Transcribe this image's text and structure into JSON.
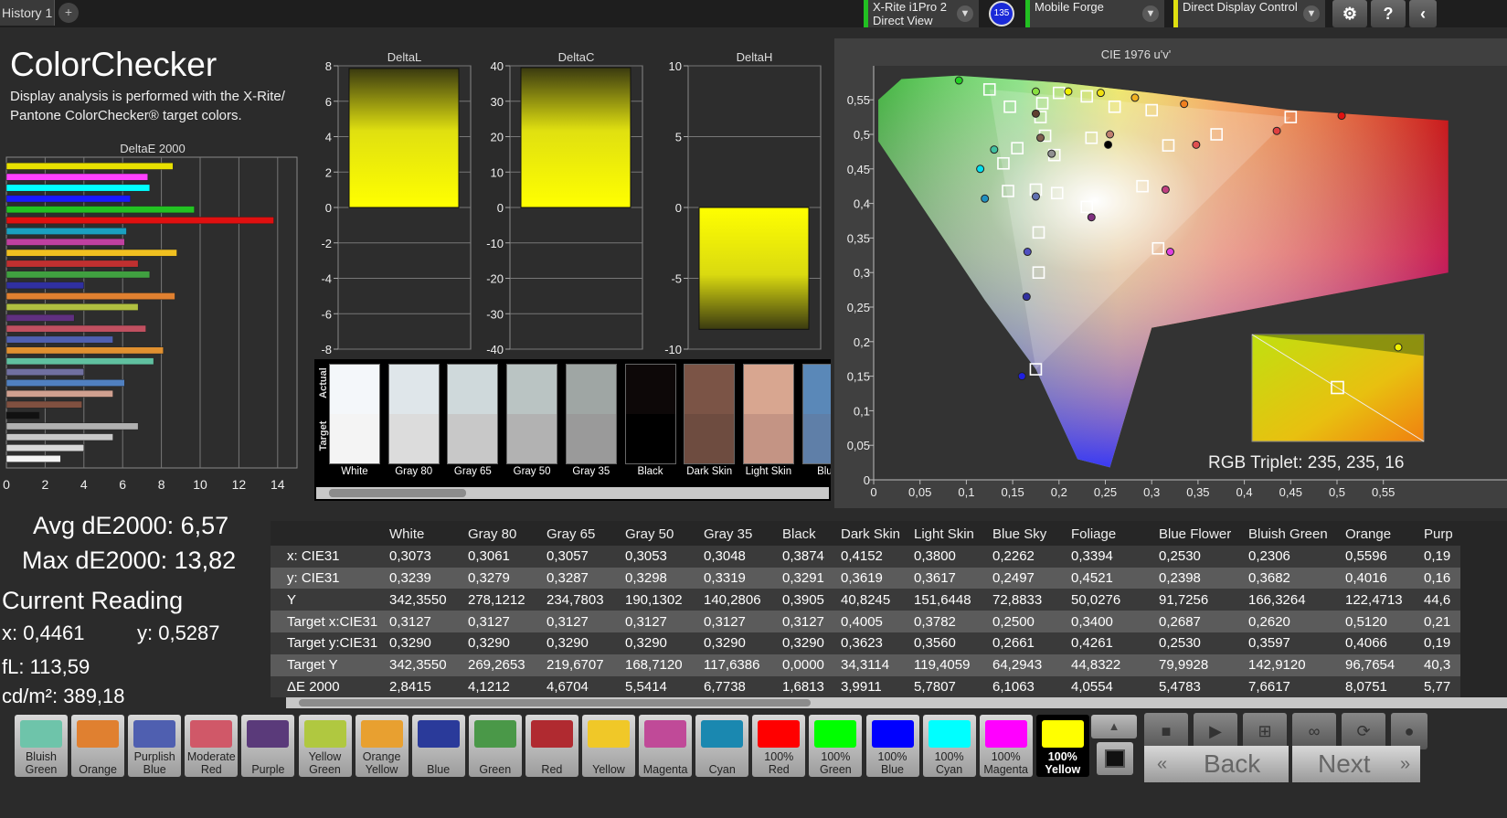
{
  "topbar": {
    "tab_label": "History 1",
    "add_tab": "+",
    "meter": {
      "line1": "X-Rite i1Pro 2",
      "line2": "Direct View"
    },
    "badge": "135",
    "profile": "Mobile Forge",
    "display_control": "Direct Display Control"
  },
  "header": {
    "title": "ColorChecker",
    "subtitle": "Display analysis is performed with the X-Rite/ Pantone ColorChecker® target colors."
  },
  "deltae_chart": {
    "title": "DeltaE 2000",
    "ticks": [
      "0",
      "2",
      "4",
      "6",
      "8",
      "10",
      "12",
      "14"
    ],
    "max": 15,
    "bars": [
      {
        "value": 8.6,
        "color": "#e8e000"
      },
      {
        "value": 7.3,
        "color": "#ff40ff"
      },
      {
        "value": 7.4,
        "color": "#00ffff"
      },
      {
        "value": 6.4,
        "color": "#1a1aff"
      },
      {
        "value": 9.7,
        "color": "#22c222"
      },
      {
        "value": 13.8,
        "color": "#e01010"
      },
      {
        "value": 6.2,
        "color": "#1aa0c0"
      },
      {
        "value": 6.1,
        "color": "#c040a0"
      },
      {
        "value": 8.8,
        "color": "#f0c020"
      },
      {
        "value": 6.8,
        "color": "#c03030"
      },
      {
        "value": 7.4,
        "color": "#40a040"
      },
      {
        "value": 4.0,
        "color": "#3030a0"
      },
      {
        "value": 8.7,
        "color": "#e08030"
      },
      {
        "value": 6.8,
        "color": "#b0c040"
      },
      {
        "value": 3.5,
        "color": "#603080"
      },
      {
        "value": 7.2,
        "color": "#c05060"
      },
      {
        "value": 5.5,
        "color": "#5060b0"
      },
      {
        "value": 8.1,
        "color": "#e09030"
      },
      {
        "value": 7.6,
        "color": "#60c0a0"
      },
      {
        "value": 4.0,
        "color": "#7070a0"
      },
      {
        "value": 6.1,
        "color": "#5080c0"
      },
      {
        "value": 5.5,
        "color": "#d0a090"
      },
      {
        "value": 3.9,
        "color": "#805040"
      },
      {
        "value": 1.7,
        "color": "#111111"
      },
      {
        "value": 6.8,
        "color": "#b0b0b0"
      },
      {
        "value": 5.5,
        "color": "#c8c8c8"
      },
      {
        "value": 4.0,
        "color": "#d8d8d8"
      },
      {
        "value": 2.8,
        "color": "#f4f4f4"
      }
    ]
  },
  "bar_charts": [
    {
      "title": "DeltaL",
      "ticks": [
        "8",
        "6",
        "4",
        "2",
        "0",
        "-2",
        "-4",
        "-6",
        "-8"
      ],
      "min": -8,
      "max": 8,
      "value": 7.85
    },
    {
      "title": "DeltaC",
      "ticks": [
        "40",
        "30",
        "20",
        "10",
        "0",
        "-10",
        "-20",
        "-30",
        "-40"
      ],
      "min": -40,
      "max": 40,
      "value": 39.5
    },
    {
      "title": "DeltaH",
      "ticks": [
        "10",
        "5",
        "0",
        "-5",
        "-10"
      ],
      "min": -10,
      "max": 10,
      "value": -8.6
    }
  ],
  "comparison": {
    "actual_label": "Actual",
    "target_label": "Target",
    "patches": [
      {
        "name": "White",
        "actual": "#f4f7fa",
        "target": "#f4f4f4"
      },
      {
        "name": "Gray 80",
        "actual": "#dfe6ea",
        "target": "#dcdcdc"
      },
      {
        "name": "Gray 65",
        "actual": "#cfd9db",
        "target": "#c8c8c8"
      },
      {
        "name": "Gray 50",
        "actual": "#bac4c3",
        "target": "#b2b2b2"
      },
      {
        "name": "Gray 35",
        "actual": "#9fa6a4",
        "target": "#9a9a9a"
      },
      {
        "name": "Black",
        "actual": "#0d0808",
        "target": "#000000"
      },
      {
        "name": "Dark Skin",
        "actual": "#7b5446",
        "target": "#6e4c40"
      },
      {
        "name": "Light Skin",
        "actual": "#d8a690",
        "target": "#c49484"
      },
      {
        "name": "Blue",
        "actual": "#5a88b8",
        "target": "#5f7fa8"
      }
    ]
  },
  "cie": {
    "title": "CIE 1976 u'v'",
    "x_ticks": [
      "0",
      "0,05",
      "0,1",
      "0,15",
      "0,2",
      "0,25",
      "0,3",
      "0,35",
      "0,4",
      "0,45",
      "0,5",
      "0,55"
    ],
    "y_ticks": [
      "0,55",
      "0,5",
      "0,45",
      "0,4",
      "0,35",
      "0,3",
      "0,25",
      "0,2",
      "0,15",
      "0,1",
      "0,05",
      "0"
    ],
    "measured": [
      {
        "u": 0.092,
        "v": 0.578,
        "color": "#22d022"
      },
      {
        "u": 0.175,
        "v": 0.562,
        "color": "#88e040"
      },
      {
        "u": 0.21,
        "v": 0.562,
        "color": "#f0f000"
      },
      {
        "u": 0.245,
        "v": 0.56,
        "color": "#f0e010"
      },
      {
        "u": 0.282,
        "v": 0.553,
        "color": "#f0b020"
      },
      {
        "u": 0.335,
        "v": 0.544,
        "color": "#f08020"
      },
      {
        "u": 0.505,
        "v": 0.527,
        "color": "#e01010"
      },
      {
        "u": 0.435,
        "v": 0.505,
        "color": "#e04040"
      },
      {
        "u": 0.348,
        "v": 0.485,
        "color": "#e05050"
      },
      {
        "u": 0.175,
        "v": 0.53,
        "color": "#604030"
      },
      {
        "u": 0.18,
        "v": 0.495,
        "color": "#806050"
      },
      {
        "u": 0.255,
        "v": 0.5,
        "color": "#c08070"
      },
      {
        "u": 0.253,
        "v": 0.485,
        "color": "#000000"
      },
      {
        "u": 0.192,
        "v": 0.472,
        "color": "#909090"
      },
      {
        "u": 0.13,
        "v": 0.478,
        "color": "#40c0a0"
      },
      {
        "u": 0.115,
        "v": 0.45,
        "color": "#00e0f0"
      },
      {
        "u": 0.12,
        "v": 0.407,
        "color": "#2090c0"
      },
      {
        "u": 0.175,
        "v": 0.41,
        "color": "#6070b0"
      },
      {
        "u": 0.315,
        "v": 0.42,
        "color": "#c04080"
      },
      {
        "u": 0.235,
        "v": 0.38,
        "color": "#803080"
      },
      {
        "u": 0.166,
        "v": 0.33,
        "color": "#5050c0"
      },
      {
        "u": 0.165,
        "v": 0.265,
        "color": "#3030a0"
      },
      {
        "u": 0.16,
        "v": 0.15,
        "color": "#2020e0"
      },
      {
        "u": 0.32,
        "v": 0.33,
        "color": "#e040e0"
      }
    ],
    "targets": [
      {
        "u": 0.125,
        "v": 0.565
      },
      {
        "u": 0.147,
        "v": 0.54
      },
      {
        "u": 0.182,
        "v": 0.545
      },
      {
        "u": 0.2,
        "v": 0.56
      },
      {
        "u": 0.23,
        "v": 0.555
      },
      {
        "u": 0.26,
        "v": 0.54
      },
      {
        "u": 0.3,
        "v": 0.535
      },
      {
        "u": 0.45,
        "v": 0.525
      },
      {
        "u": 0.18,
        "v": 0.525
      },
      {
        "u": 0.185,
        "v": 0.498
      },
      {
        "u": 0.235,
        "v": 0.495
      },
      {
        "u": 0.37,
        "v": 0.5
      },
      {
        "u": 0.318,
        "v": 0.484
      },
      {
        "u": 0.155,
        "v": 0.48
      },
      {
        "u": 0.14,
        "v": 0.458
      },
      {
        "u": 0.195,
        "v": 0.47
      },
      {
        "u": 0.145,
        "v": 0.418
      },
      {
        "u": 0.175,
        "v": 0.42
      },
      {
        "u": 0.198,
        "v": 0.415
      },
      {
        "u": 0.29,
        "v": 0.425
      },
      {
        "u": 0.23,
        "v": 0.395
      },
      {
        "u": 0.178,
        "v": 0.358
      },
      {
        "u": 0.307,
        "v": 0.335
      },
      {
        "u": 0.178,
        "v": 0.3
      },
      {
        "u": 0.175,
        "v": 0.16
      }
    ],
    "inset_caption": "RGB Triplet: 235, 235, 16"
  },
  "readings": {
    "avg": "Avg dE2000: 6,57",
    "max": "Max dE2000: 13,82",
    "current_title": "Current Reading",
    "x": "x: 0,4461",
    "y": "y: 0,5287",
    "fl": "fL: 113,59",
    "cd": "cd/m²: 389,18"
  },
  "table": {
    "columns": [
      "",
      "White",
      "Gray 80",
      "Gray 65",
      "Gray 50",
      "Gray 35",
      "Black",
      "Dark Skin",
      "Light Skin",
      "Blue Sky",
      "Foliage",
      "Blue Flower",
      "Bluish Green",
      "Orange",
      "Purp"
    ],
    "rows": [
      [
        "x: CIE31",
        "0,3073",
        "0,3061",
        "0,3057",
        "0,3053",
        "0,3048",
        "0,3874",
        "0,4152",
        "0,3800",
        "0,2262",
        "0,3394",
        "0,2530",
        "0,2306",
        "0,5596",
        "0,19"
      ],
      [
        "y: CIE31",
        "0,3239",
        "0,3279",
        "0,3287",
        "0,3298",
        "0,3319",
        "0,3291",
        "0,3619",
        "0,3617",
        "0,2497",
        "0,4521",
        "0,2398",
        "0,3682",
        "0,4016",
        "0,16"
      ],
      [
        "Y",
        "342,3550",
        "278,1212",
        "234,7803",
        "190,1302",
        "140,2806",
        "0,3905",
        "40,8245",
        "151,6448",
        "72,8833",
        "50,0276",
        "91,7256",
        "166,3264",
        "122,4713",
        "44,6"
      ],
      [
        "Target x:CIE31",
        "0,3127",
        "0,3127",
        "0,3127",
        "0,3127",
        "0,3127",
        "0,3127",
        "0,4005",
        "0,3782",
        "0,2500",
        "0,3400",
        "0,2687",
        "0,2620",
        "0,5120",
        "0,21"
      ],
      [
        "Target y:CIE31",
        "0,3290",
        "0,3290",
        "0,3290",
        "0,3290",
        "0,3290",
        "0,3290",
        "0,3623",
        "0,3560",
        "0,2661",
        "0,4261",
        "0,2530",
        "0,3597",
        "0,4066",
        "0,19"
      ],
      [
        "Target Y",
        "342,3550",
        "269,2653",
        "219,6707",
        "168,7120",
        "117,6386",
        "0,0000",
        "34,3114",
        "119,4059",
        "64,2943",
        "44,8322",
        "79,9928",
        "142,9120",
        "96,7654",
        "40,3"
      ],
      [
        "ΔE 2000",
        "2,8415",
        "4,1212",
        "4,6704",
        "5,5414",
        "6,7738",
        "1,6813",
        "3,9911",
        "5,7807",
        "6,1063",
        "4,0554",
        "5,4783",
        "7,6617",
        "8,0751",
        "5,77"
      ]
    ]
  },
  "swatches": [
    {
      "label": "Bluish Green",
      "color": "#6ec4aa"
    },
    {
      "label": "Orange",
      "color": "#e08030"
    },
    {
      "label": "Purplish Blue",
      "color": "#4f5fb0"
    },
    {
      "label": "Moderate Red",
      "color": "#d05868"
    },
    {
      "label": "Purple",
      "color": "#5a3a7a"
    },
    {
      "label": "Yellow Green",
      "color": "#b0c840"
    },
    {
      "label": "Orange Yellow",
      "color": "#e8a030"
    },
    {
      "label": "Blue",
      "color": "#2a3a9a"
    },
    {
      "label": "Green",
      "color": "#4a9848"
    },
    {
      "label": "Red",
      "color": "#b02a30"
    },
    {
      "label": "Yellow",
      "color": "#f0c828"
    },
    {
      "label": "Magenta",
      "color": "#c04a98"
    },
    {
      "label": "Cyan",
      "color": "#1a88b0"
    },
    {
      "label": "100% Red",
      "color": "#ff0000"
    },
    {
      "label": "100% Green",
      "color": "#00ff00"
    },
    {
      "label": "100% Blue",
      "color": "#0000ff"
    },
    {
      "label": "100% Cyan",
      "color": "#00ffff"
    },
    {
      "label": "100% Magenta",
      "color": "#ff00ff"
    },
    {
      "label": "100% Yellow",
      "color": "#ffff00"
    }
  ],
  "nav": {
    "back": "Back",
    "next": "Next",
    "back_icon": "«",
    "next_icon": "»"
  }
}
